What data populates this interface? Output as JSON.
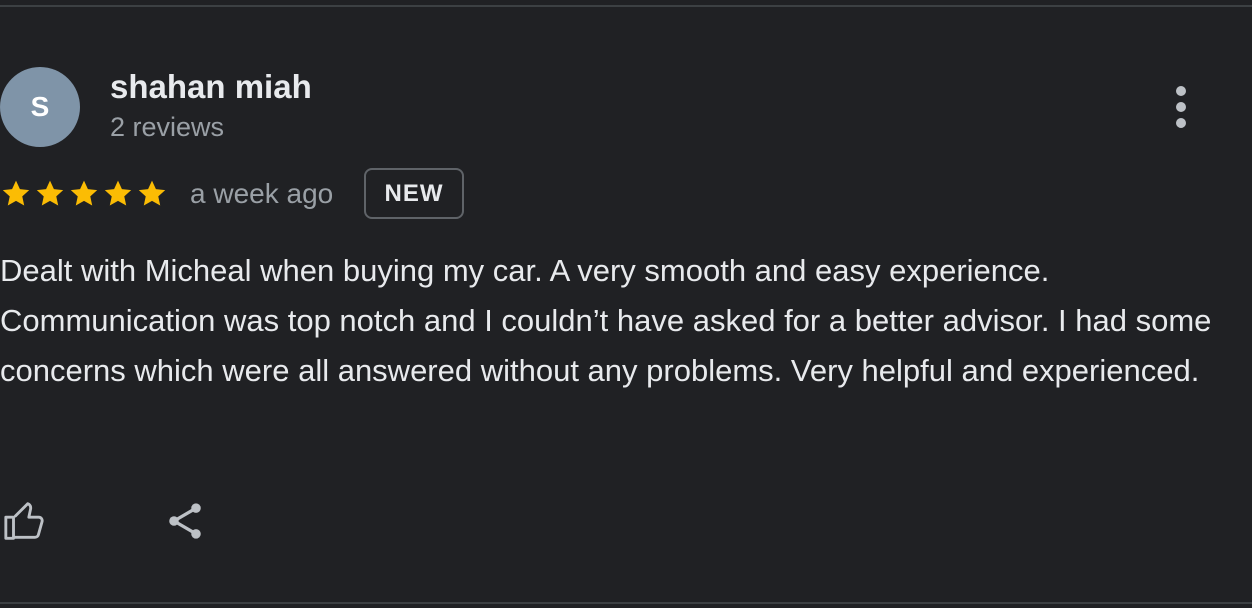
{
  "review": {
    "avatar_initial": "S",
    "reviewer_name": "shahan miah",
    "review_count": "2 reviews",
    "rating": 5,
    "rating_max": 5,
    "date": "a week ago",
    "badge": "NEW",
    "text": "Dealt with Micheal when buying my car. A very smooth and easy experience. Communication was top notch and I couldn’t have asked for a better advisor. I had some concerns which were all answered without any problems. Very helpful and experienced."
  },
  "actions": {
    "like_icon": "thumb-up-icon",
    "share_icon": "share-icon",
    "more_icon": "more-vert-icon"
  },
  "colors": {
    "background": "#202124",
    "star": "#fbbc04",
    "avatar": "#7f94a8",
    "primary_text": "#e8eaed",
    "secondary_text": "#9aa0a6"
  }
}
